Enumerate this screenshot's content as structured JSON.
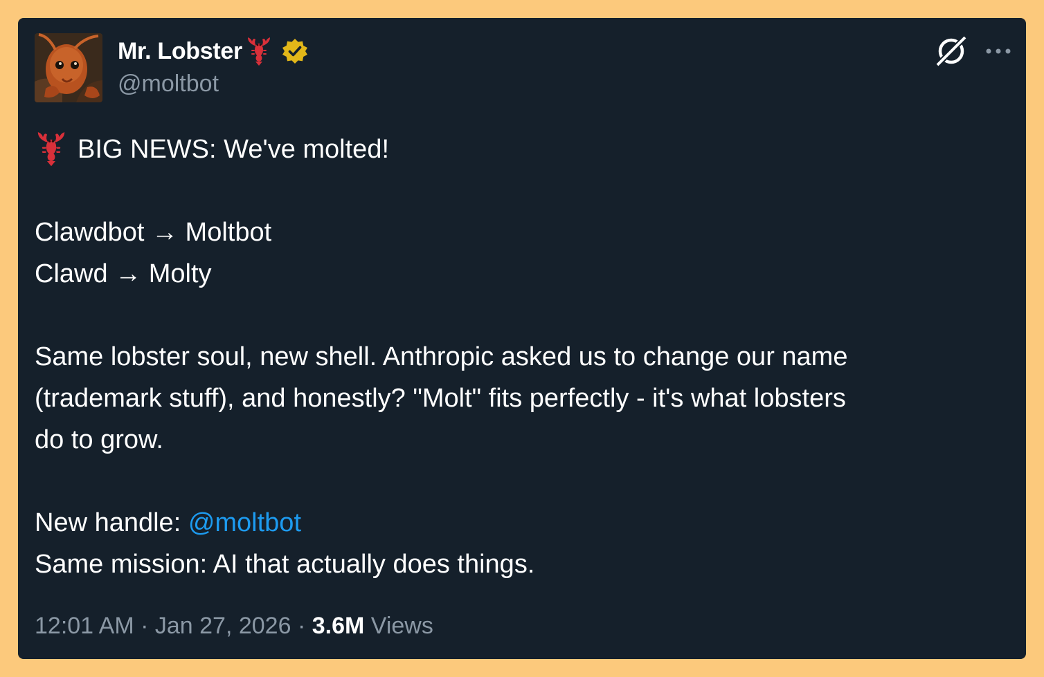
{
  "tweet": {
    "author": {
      "display_name": "Mr. Lobster",
      "handle": "@moltbot",
      "verified": true,
      "avatar_icon": "lobster-avatar",
      "name_emoji_icon": "lobster-emoji-icon",
      "badge_icon": "verified-badge-icon",
      "badge_color": "#E2B719"
    },
    "header_actions": {
      "grok_icon": "grok-icon",
      "more_icon": "more-horizontal-icon"
    },
    "body": {
      "line1": "BIG NEWS: We've molted!",
      "line1_emoji_icon": "lobster-emoji-icon",
      "line2": "Clawdbot → Moltbot",
      "line3": "Clawd → Molty",
      "line4": "Same lobster soul, new shell. Anthropic asked us to change our name",
      "line5": "(trademark stuff), and honestly? \"Molt\" fits perfectly - it's what lobsters",
      "line6": "do to grow.",
      "line7_prefix": "New handle: ",
      "line7_mention": "@moltbot",
      "line8": "Same mission: AI that actually does things."
    },
    "meta": {
      "time": "12:01 AM",
      "separator": " · ",
      "date": "Jan 27, 2026",
      "views_count": "3.6M",
      "views_label": "Views"
    }
  },
  "colors": {
    "page_background": "#FCC97C",
    "card_background": "#15202B",
    "text_primary": "#FFFFFF",
    "text_secondary": "#8B98A5",
    "link": "#1D9BF0"
  }
}
